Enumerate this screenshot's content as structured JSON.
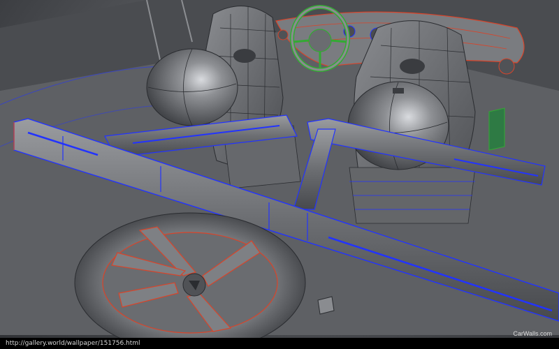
{
  "image": {
    "caption_url": "http://gallery.world/wallpaper/151756.html",
    "watermark_text": "CarWalls.com"
  },
  "colors": {
    "wire_blue": "#2233ff",
    "wire_red": "#d8442a",
    "wire_green": "#33aa33",
    "surface_gray": "#6e7074",
    "highlight": "#e0e2e6",
    "caption_bar": "#000000"
  }
}
